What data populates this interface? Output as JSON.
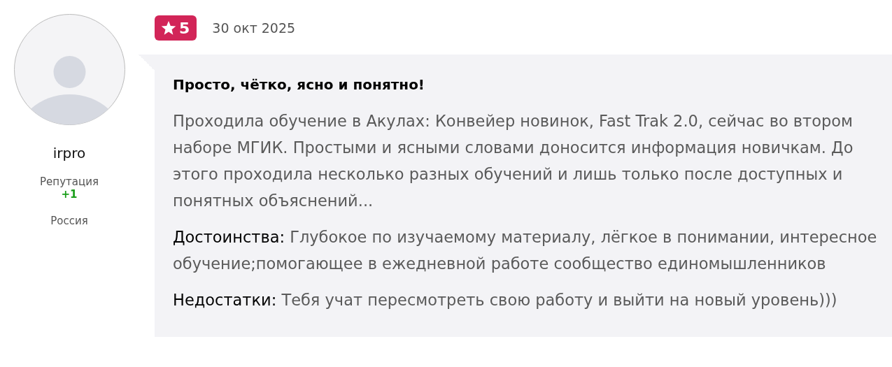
{
  "author": {
    "name": "irpro",
    "reputation_label": "Репутация",
    "reputation_value": "+1",
    "country": "Россия"
  },
  "review": {
    "rating": "5",
    "date": "30 окт 2025",
    "title": "Просто, чётко, ясно и понятно!",
    "body": "Проходила обучение в Акулах: Конвейер новинок, Fast Trak 2.0, сейчас во втором наборе МГИК. Простыми и ясными словами доносится информация новичкам. До этого проходила несколько разных обучений и лишь только после доступных и понятных объяснений...",
    "sections": [
      {
        "label": "Достоинства:",
        "text": "Глубокое по изучаемому материалу, лёгкое в понимании, интересное обучение;помогающее в ежедневной работе сообщество единомышленников"
      },
      {
        "label": "Недостатки:",
        "text": "Тебя учат пересмотреть свою работу и выйти на новый уровень)))"
      }
    ]
  }
}
